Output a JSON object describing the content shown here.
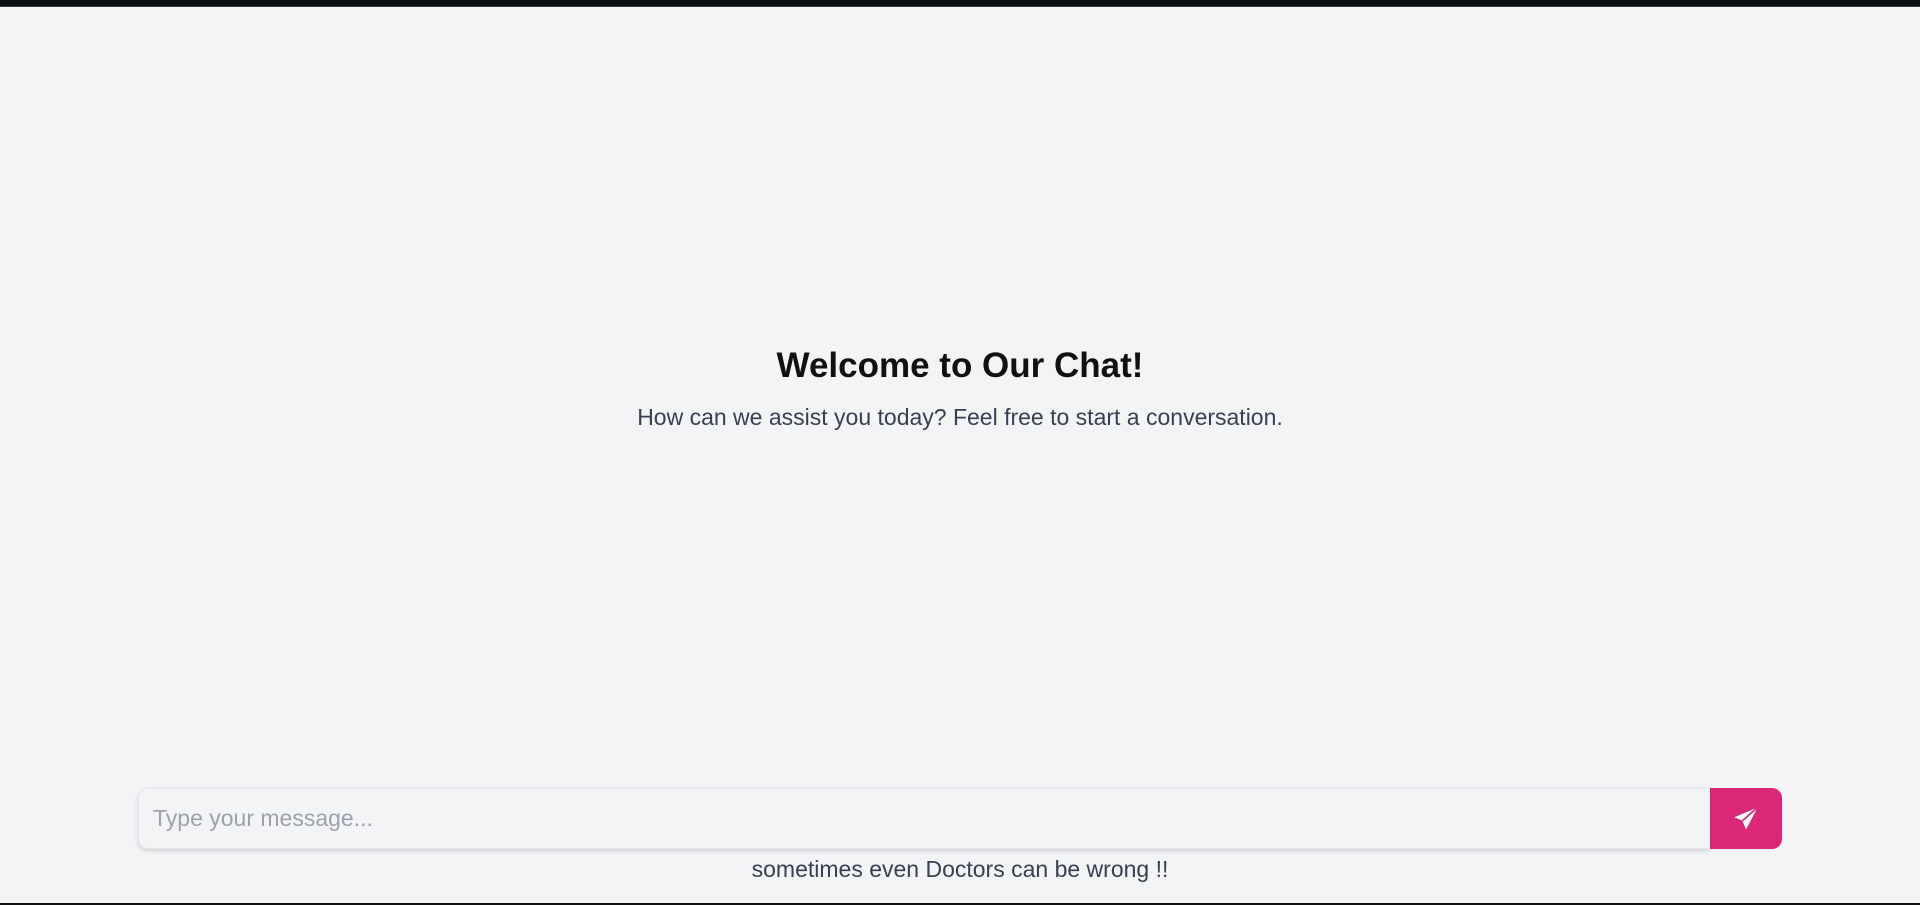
{
  "welcome": {
    "title": "Welcome to Our Chat!",
    "subtitle": "How can we assist you today? Feel free to start a conversation."
  },
  "composer": {
    "placeholder": "Type your message...",
    "value": "",
    "send_icon": "paper-plane-icon"
  },
  "footer": {
    "disclaimer": "sometimes even Doctors can be wrong !!"
  },
  "colors": {
    "background": "#f3f4f6",
    "accent": "#db2777",
    "title_text": "#111111",
    "body_text": "#374151",
    "placeholder_text": "#9ca3af"
  }
}
